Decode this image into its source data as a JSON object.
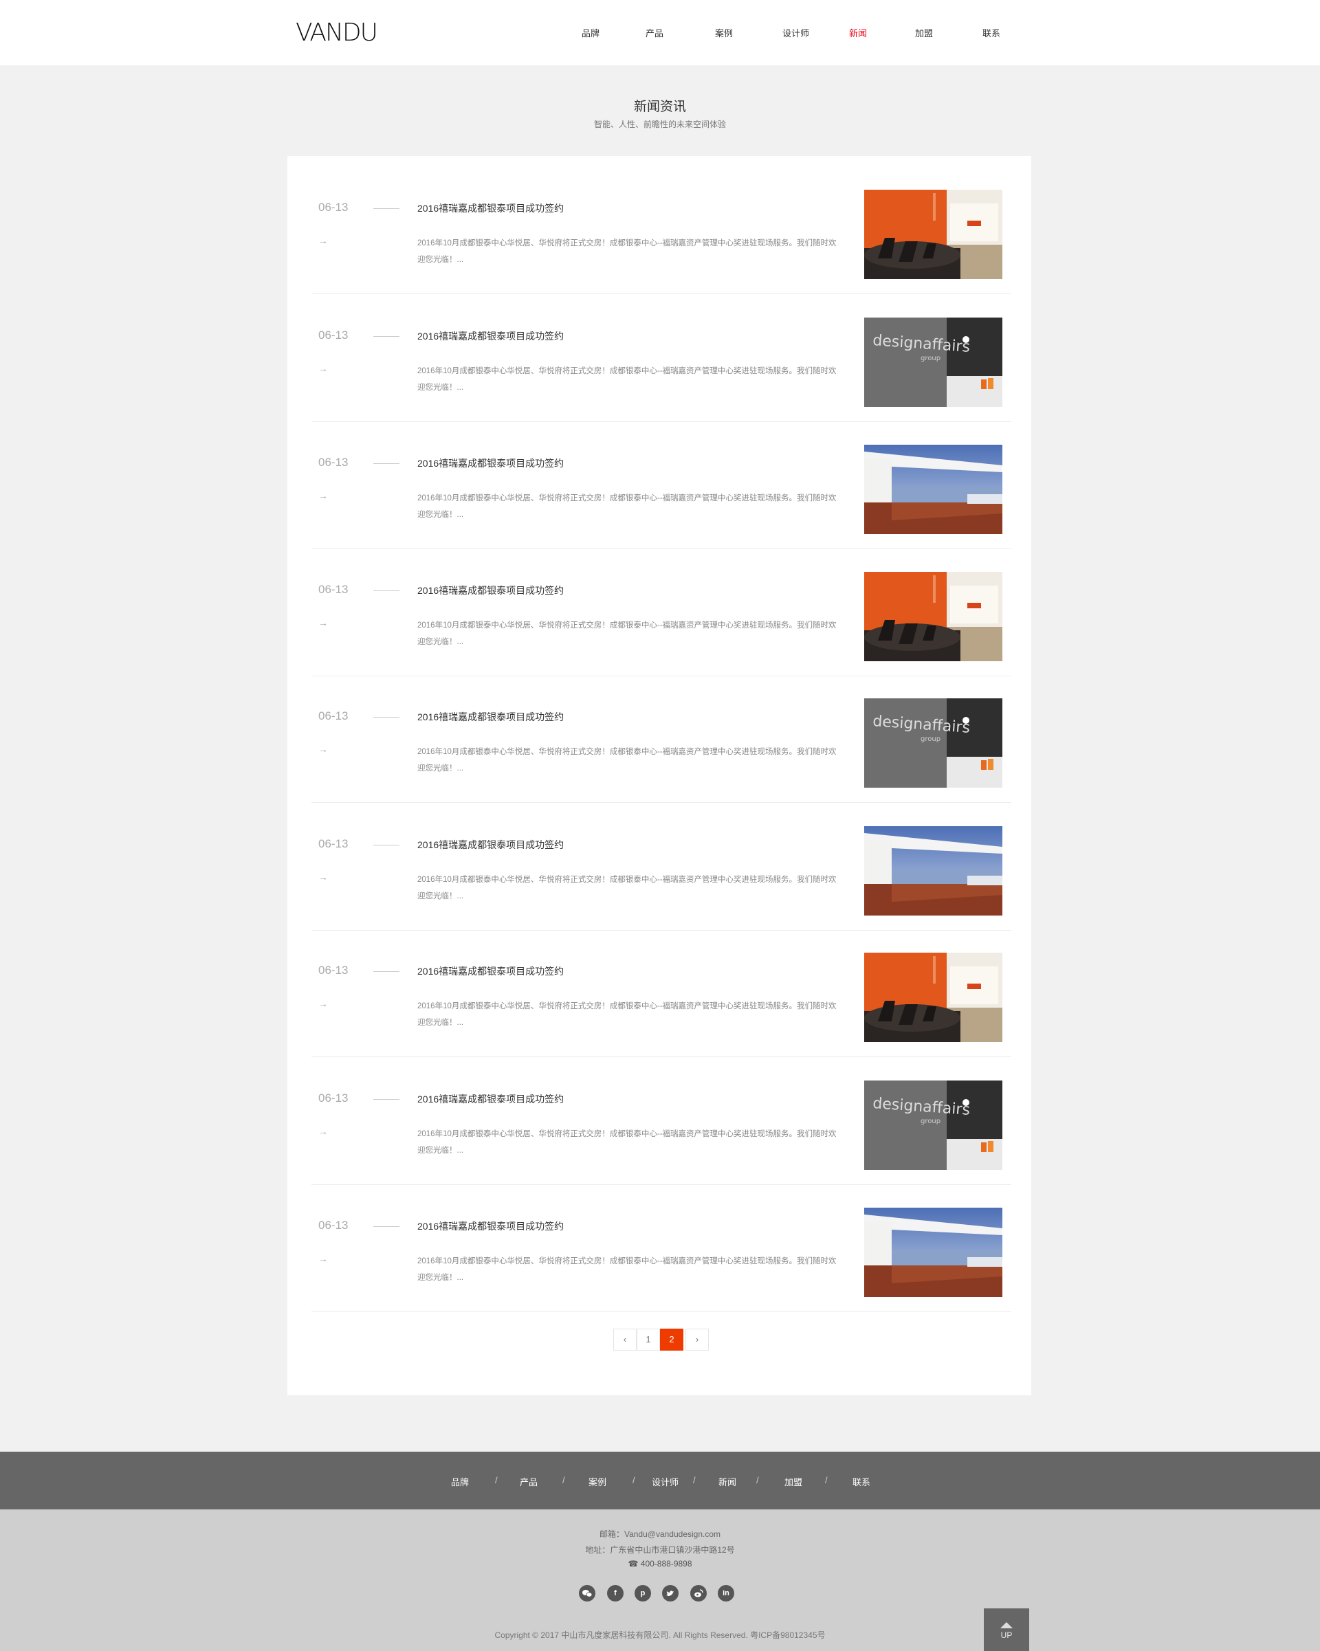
{
  "header": {
    "logo": "VANDU",
    "nav": [
      {
        "label": "品牌",
        "active": false
      },
      {
        "label": "产品",
        "active": false
      },
      {
        "label": "案例",
        "active": false
      },
      {
        "label": "设计师",
        "active": false
      },
      {
        "label": "新闻",
        "active": true
      },
      {
        "label": "加盟",
        "active": false
      },
      {
        "label": "联系",
        "active": false
      }
    ]
  },
  "page": {
    "title": "新闻资讯",
    "subtitle": "智能、人性、前瞻性的未来空间体验"
  },
  "news": [
    {
      "date": "06-13",
      "arrow": "→",
      "title": "2016禧瑞嘉成都银泰项目成功签约",
      "desc": "2016年10月成都银泰中心华悦居、华悦府将正式交房！成都银泰中心--福瑞嘉资产管理中心奖进驻现场服务。我们随时欢迎您光临！...",
      "image": "office-orange"
    },
    {
      "date": "06-13",
      "arrow": "→",
      "title": "2016禧瑞嘉成都银泰项目成功签约",
      "desc": "2016年10月成都银泰中心华悦居、华悦府将正式交房！成都银泰中心--福瑞嘉资产管理中心奖进驻现场服务。我们随时欢迎您光临！...",
      "image": "designaffairs-wall"
    },
    {
      "date": "06-13",
      "arrow": "→",
      "title": "2016禧瑞嘉成都银泰项目成功签约",
      "desc": "2016年10月成都银泰中心华悦居、华悦府将正式交房！成都银泰中心--福瑞嘉资产管理中心奖进驻现场服务。我们随时欢迎您光临！...",
      "image": "terrace-sea"
    },
    {
      "date": "06-13",
      "arrow": "→",
      "title": "2016禧瑞嘉成都银泰项目成功签约",
      "desc": "2016年10月成都银泰中心华悦居、华悦府将正式交房！成都银泰中心--福瑞嘉资产管理中心奖进驻现场服务。我们随时欢迎您光临！...",
      "image": "office-orange"
    },
    {
      "date": "06-13",
      "arrow": "→",
      "title": "2016禧瑞嘉成都银泰项目成功签约",
      "desc": "2016年10月成都银泰中心华悦居、华悦府将正式交房！成都银泰中心--福瑞嘉资产管理中心奖进驻现场服务。我们随时欢迎您光临！...",
      "image": "designaffairs-wall"
    },
    {
      "date": "06-13",
      "arrow": "→",
      "title": "2016禧瑞嘉成都银泰项目成功签约",
      "desc": "2016年10月成都银泰中心华悦居、华悦府将正式交房！成都银泰中心--福瑞嘉资产管理中心奖进驻现场服务。我们随时欢迎您光临！...",
      "image": "terrace-sea"
    },
    {
      "date": "06-13",
      "arrow": "→",
      "title": "2016禧瑞嘉成都银泰项目成功签约",
      "desc": "2016年10月成都银泰中心华悦居、华悦府将正式交房！成都银泰中心--福瑞嘉资产管理中心奖进驻现场服务。我们随时欢迎您光临！...",
      "image": "office-orange"
    },
    {
      "date": "06-13",
      "arrow": "→",
      "title": "2016禧瑞嘉成都银泰项目成功签约",
      "desc": "2016年10月成都银泰中心华悦居、华悦府将正式交房！成都银泰中心--福瑞嘉资产管理中心奖进驻现场服务。我们随时欢迎您光临！...",
      "image": "designaffairs-wall"
    },
    {
      "date": "06-13",
      "arrow": "→",
      "title": "2016禧瑞嘉成都银泰项目成功签约",
      "desc": "2016年10月成都银泰中心华悦居、华悦府将正式交房！成都银泰中心--福瑞嘉资产管理中心奖进驻现场服务。我们随时欢迎您光临！...",
      "image": "terrace-sea"
    }
  ],
  "pagination": {
    "prev": "‹",
    "pages": [
      "1",
      "2"
    ],
    "current": "2",
    "next": "›"
  },
  "footer": {
    "nav": [
      "品牌",
      "产品",
      "案例",
      "设计师",
      "新闻",
      "加盟",
      "联系"
    ],
    "separator": "/",
    "email": "邮箱：Vandu@vandudesign.com",
    "address": "地址：广东省中山市港口镇沙港中路12号",
    "phone": "400-888-9898",
    "socials": [
      "wechat-icon",
      "facebook-icon",
      "pinterest-icon",
      "twitter-icon",
      "weibo-icon",
      "linkedin-icon"
    ],
    "copyright": "Copyright © 2017 中山市凡度家居科技有限公司. All Rights Reserved.     粤ICP备98012345号",
    "up_label": "UP"
  },
  "colors": {
    "accent": "#ee3b00",
    "nav_active": "#e60012",
    "footer_nav_bg": "#666666",
    "footer_bg": "#cfcfcf"
  }
}
